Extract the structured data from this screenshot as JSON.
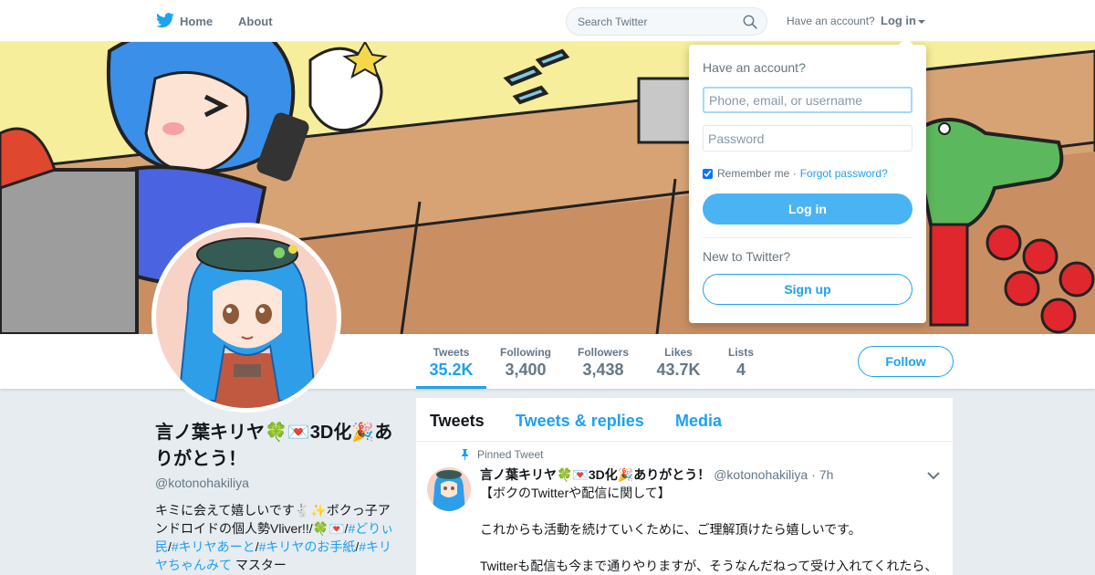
{
  "nav": {
    "home_label": "Home",
    "about_label": "About",
    "search_placeholder": "Search Twitter",
    "have_account": "Have an account?",
    "login_label": "Log in"
  },
  "stats": [
    {
      "label": "Tweets",
      "value": "35.2K"
    },
    {
      "label": "Following",
      "value": "3,400"
    },
    {
      "label": "Followers",
      "value": "3,438"
    },
    {
      "label": "Likes",
      "value": "43.7K"
    },
    {
      "label": "Lists",
      "value": "4"
    }
  ],
  "follow_label": "Follow",
  "profile": {
    "name": "言ノ葉キリヤ🍀💌3D化🎉ありがとう！",
    "handle": "@kotonohakiliya",
    "bio_text1": "キミに会えて嬉しいです🐇✨ボクっ子アンドロイドの個人勢Vliver!!/🍀💌/",
    "bio_tag1": "#どりぃ民",
    "bio_sep1": "/",
    "bio_tag2": "#キリヤあーと",
    "bio_sep2": "/",
    "bio_tag3": "#キリヤのお手紙",
    "bio_sep3": "/",
    "bio_tag4": "#キリヤちゃんみて",
    "bio_text2": " マスター"
  },
  "timeline": {
    "tabs": [
      "Tweets",
      "Tweets & replies",
      "Media"
    ],
    "pinned_label": "Pinned Tweet",
    "tweet": {
      "name": "言ノ葉キリヤ🍀💌3D化🎉ありがとう！",
      "handle": "@kotonohakiliya",
      "time": "7h",
      "line1": "【ボクのTwitterや配信に関して】",
      "line2": "これからも活動を続けていくために、ご理解頂けたら嬉しいです。",
      "line3": "Twitterも配信も今まで通りやりますが、そうなんだねって受け入れてくれたら、"
    }
  },
  "login": {
    "title": "Have an account?",
    "user_placeholder": "Phone, email, or username",
    "pass_placeholder": "Password",
    "remember": "Remember me",
    "separator": "·",
    "forgot": "Forgot password?",
    "button": "Log in",
    "new_to": "New to Twitter?",
    "signup": "Sign up"
  },
  "colors": {
    "accent": "#1da1f2",
    "login_button": "#4ab3f4",
    "page_bg": "#e6ecf0"
  }
}
